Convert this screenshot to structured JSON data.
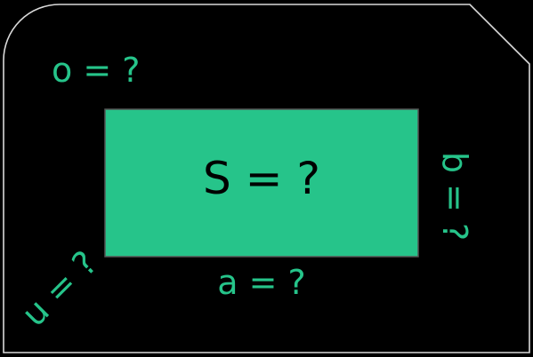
{
  "colors": {
    "background": "#000000",
    "frame_stroke": "#d9d9d9",
    "rectangle_fill": "#26c48a",
    "rectangle_stroke": "#555555",
    "label_color": "#26c48a",
    "area_label_color": "#000000"
  },
  "labels": {
    "perimeter": "o = ?",
    "area": "S = ?",
    "side_b": "b = ?",
    "side_a": "a = ?",
    "diagonal_u": "u = ?"
  }
}
